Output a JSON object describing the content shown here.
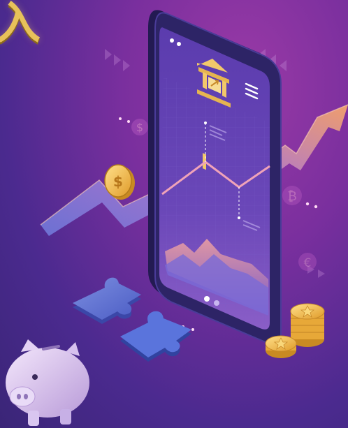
{
  "title_fragment": "入",
  "icons": {
    "bank": "bank-icon",
    "menu": "hamburger-menu-icon",
    "coin": "dollar-coin-icon",
    "currencies": [
      "euro-icon",
      "bitcoin-icon",
      "dollar-icon"
    ]
  },
  "colors": {
    "background_top": "#9a3aa6",
    "background_bottom": "#3a2577",
    "gold": "#e7c15a",
    "arrow_start": "#6d74d6",
    "arrow_end": "#f4a36b",
    "phone_body": "#2a1f5e",
    "phone_screen": "#5a3aa8"
  },
  "phone": {
    "carousel_dots": 2,
    "active_dot": 0
  }
}
